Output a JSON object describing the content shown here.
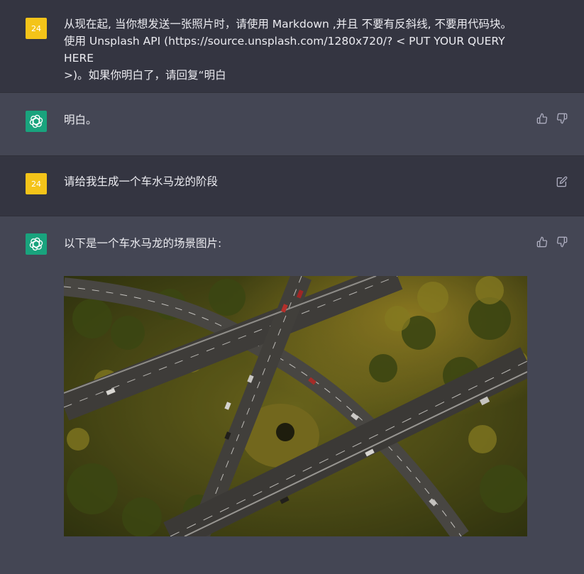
{
  "conversation": {
    "user_avatar_label": "24",
    "messages": [
      {
        "role": "user",
        "lines": [
          "从现在起, 当你想发送一张照片时，请使用 Markdown ,并且 不要有反斜线, 不要用代码块。",
          "使用 Unsplash API (https://source.unsplash.com/1280x720/? < PUT YOUR QUERY HERE",
          ">)。如果你明白了，请回复“明白"
        ]
      },
      {
        "role": "assistant",
        "text": "明白。"
      },
      {
        "role": "user",
        "text": "请给我生成一个车水马龙的阶段"
      },
      {
        "role": "assistant",
        "text": "以下是一个车水马龙的场景图片:",
        "image_subject": "aerial-highway-interchange-forest"
      }
    ]
  },
  "icons": {
    "like": "thumbs-up-icon",
    "dislike": "thumbs-down-icon",
    "edit": "edit-icon",
    "assistant_logo": "openai-logo-icon"
  },
  "colors": {
    "user_bg": "#343541",
    "assistant_bg": "#444654",
    "user_avatar": "#f4c419",
    "assistant_avatar": "#19a37d",
    "text": "#ececf1",
    "icon": "#acacbe"
  }
}
